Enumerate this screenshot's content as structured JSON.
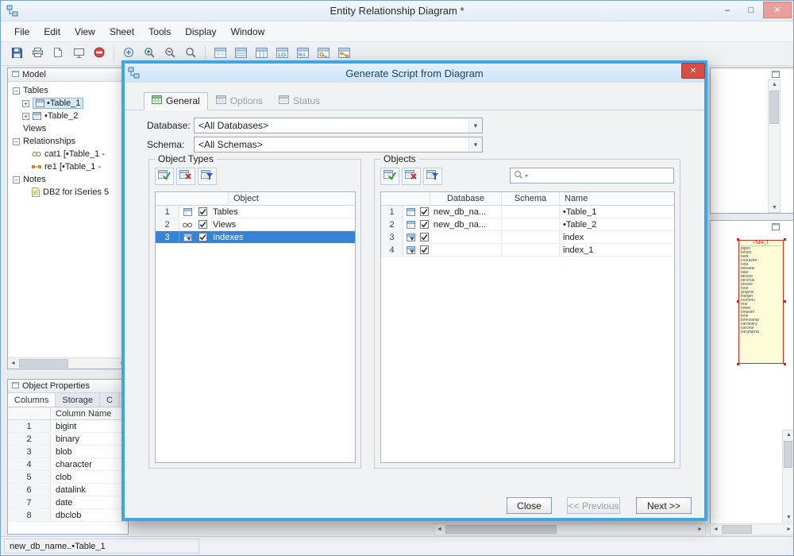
{
  "colors": {
    "dialog_border": "#3fa6e2",
    "dialog_titlebar": "#d7e8f8",
    "close_button_red": "#d74f44",
    "selection_blue": "#3584d6",
    "tree_selection": "#d6e7f8",
    "preview_fill": "#fdfcd8",
    "preview_outline": "#cc3322",
    "window_close_button": "#e8a09a"
  },
  "glyphs": {
    "minimize": "–",
    "maximize": "□",
    "close": "✕",
    "up": "▲",
    "down": "▼",
    "left": "◄",
    "right": "►",
    "combo_arrow": "▾",
    "search_caret": "▾",
    "plus": "+",
    "minus": "−"
  },
  "window": {
    "title": "Entity Relationship Diagram *"
  },
  "menu": {
    "items": [
      "File",
      "Edit",
      "View",
      "Sheet",
      "Tools",
      "Display",
      "Window"
    ]
  },
  "model_panel": {
    "title": "Model",
    "tree": [
      {
        "label": "Tables"
      },
      {
        "label": "•Table_1"
      },
      {
        "label": "•Table_2"
      },
      {
        "label": "Views"
      },
      {
        "label": "Relationships"
      },
      {
        "label": "cat1 [•Table_1 -"
      },
      {
        "label": "re1 [•Table_1 -"
      },
      {
        "label": "Notes"
      },
      {
        "label": "DB2 for iSeries 5"
      }
    ]
  },
  "object_properties": {
    "title": "Object Properties",
    "tabs": [
      "Columns",
      "Storage",
      "C"
    ],
    "column_header": "Column Name",
    "rows": [
      {
        "num": "1",
        "name": "bigint"
      },
      {
        "num": "2",
        "name": "binary"
      },
      {
        "num": "3",
        "name": "blob"
      },
      {
        "num": "4",
        "name": "character"
      },
      {
        "num": "5",
        "name": "clob"
      },
      {
        "num": "6",
        "name": "datalink"
      },
      {
        "num": "7",
        "name": "date"
      },
      {
        "num": "8",
        "name": "dbclob"
      }
    ]
  },
  "preview": {
    "title": "•Table_1",
    "lines": [
      "bigint",
      "binary",
      "blob",
      "character",
      "clob",
      "datalink",
      "date",
      "dbclob",
      "decimal",
      "double",
      "float",
      "graphic",
      "integer",
      "numeric",
      "real",
      "rowid",
      "smallint",
      "time",
      "timestamp",
      "varbinary",
      "varchar",
      "vargraphic"
    ]
  },
  "status_bar": {
    "text": "new_db_name..•Table_1"
  },
  "dialog": {
    "title": "Generate Script from Diagram",
    "tabs": [
      {
        "label": "General"
      },
      {
        "label": "Options"
      },
      {
        "label": "Status"
      }
    ],
    "form": {
      "database_label": "Database:",
      "database_value": "<All Databases>",
      "schema_label": "Schema:",
      "schema_value": "<All Schemas>"
    },
    "object_types": {
      "title": "Object Types",
      "column_header": "Object",
      "rows": [
        {
          "num": "1",
          "label": "Tables"
        },
        {
          "num": "2",
          "label": "Views"
        },
        {
          "num": "3",
          "label": "Indexes"
        }
      ]
    },
    "objects": {
      "title": "Objects",
      "headers": {
        "database": "Database",
        "schema": "Schema",
        "name": "Name"
      },
      "rows": [
        {
          "num": "1",
          "database": "new_db_na...",
          "schema": "",
          "name": "•Table_1"
        },
        {
          "num": "2",
          "database": "new_db_na...",
          "schema": "",
          "name": "•Table_2"
        },
        {
          "num": "3",
          "database": "",
          "schema": "",
          "name": "index"
        },
        {
          "num": "4",
          "database": "",
          "schema": "",
          "name": "index_1"
        }
      ]
    },
    "buttons": {
      "close": "Close",
      "previous": "<< Previous",
      "next": "Next >>"
    }
  }
}
